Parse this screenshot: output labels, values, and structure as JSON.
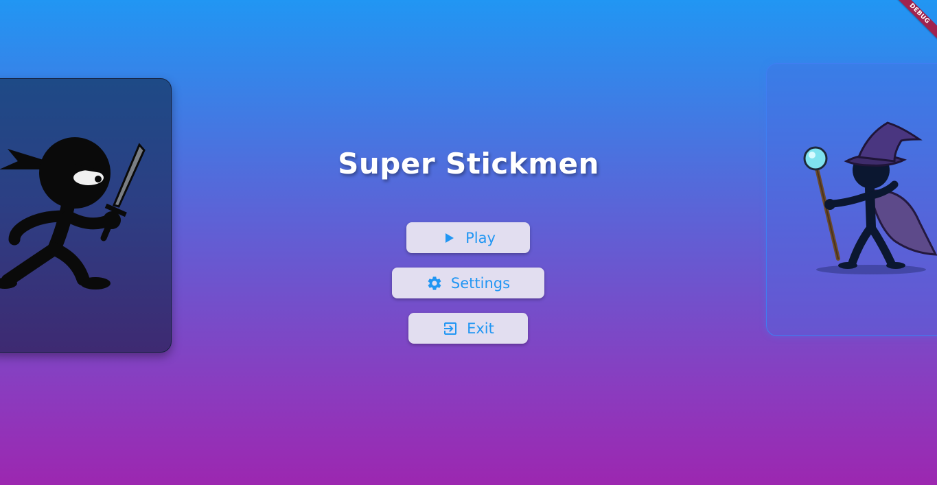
{
  "app": {
    "title": "Super Stickmen",
    "debug_banner": "DEBUG"
  },
  "menu": {
    "play": {
      "label": "Play",
      "icon": "play-icon"
    },
    "settings": {
      "label": "Settings",
      "icon": "gear-icon"
    },
    "exit": {
      "label": "Exit",
      "icon": "exit-icon"
    }
  },
  "characters": {
    "left": {
      "name": "ninja-stickman",
      "selected": true
    },
    "right": {
      "name": "wizard-stickman",
      "selected": false
    }
  },
  "colors": {
    "accent": "#2196f3",
    "button_bg": "#e2def0",
    "gradient_top": "#2196f3",
    "gradient_bottom": "#9c27b0",
    "debug_ribbon": "#a0224e"
  }
}
